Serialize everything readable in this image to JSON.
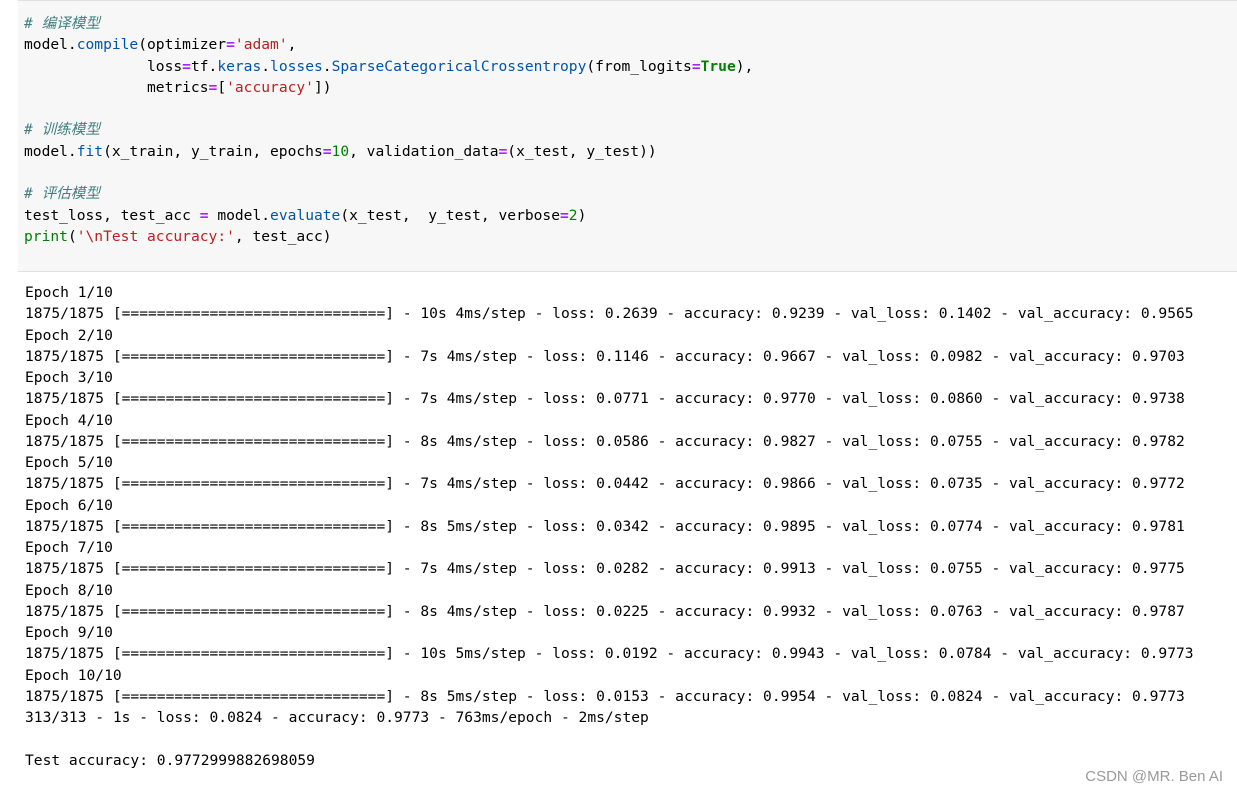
{
  "code": {
    "lines": [
      {
        "type": "comment",
        "text": "# 编译模型"
      },
      {
        "type": "code",
        "parts": [
          {
            "t": "model."
          },
          {
            "t": "compile",
            "c": "attr"
          },
          {
            "t": "(optimizer"
          },
          {
            "t": "=",
            "c": "op"
          },
          {
            "t": "'adam'",
            "c": "str"
          },
          {
            "t": ","
          }
        ]
      },
      {
        "type": "code",
        "parts": [
          {
            "t": "              loss"
          },
          {
            "t": "=",
            "c": "op"
          },
          {
            "t": "tf."
          },
          {
            "t": "keras",
            "c": "attr"
          },
          {
            "t": "."
          },
          {
            "t": "losses",
            "c": "attr"
          },
          {
            "t": "."
          },
          {
            "t": "SparseCategoricalCrossentropy",
            "c": "attr"
          },
          {
            "t": "(from_logits"
          },
          {
            "t": "=",
            "c": "op"
          },
          {
            "t": "True",
            "c": "kw"
          },
          {
            "t": "),"
          }
        ]
      },
      {
        "type": "code",
        "parts": [
          {
            "t": "              metrics"
          },
          {
            "t": "=",
            "c": "op"
          },
          {
            "t": "["
          },
          {
            "t": "'accuracy'",
            "c": "str"
          },
          {
            "t": "])"
          }
        ]
      },
      {
        "type": "blank"
      },
      {
        "type": "comment",
        "text": "# 训练模型"
      },
      {
        "type": "code",
        "parts": [
          {
            "t": "model."
          },
          {
            "t": "fit",
            "c": "attr"
          },
          {
            "t": "(x_train, y_train, epochs"
          },
          {
            "t": "=",
            "c": "op"
          },
          {
            "t": "10",
            "c": "num"
          },
          {
            "t": ", validation_data"
          },
          {
            "t": "=",
            "c": "op"
          },
          {
            "t": "(x_test, y_test))"
          }
        ]
      },
      {
        "type": "blank"
      },
      {
        "type": "comment",
        "text": "# 评估模型"
      },
      {
        "type": "code",
        "parts": [
          {
            "t": "test_loss, test_acc "
          },
          {
            "t": "=",
            "c": "op"
          },
          {
            "t": " model."
          },
          {
            "t": "evaluate",
            "c": "attr"
          },
          {
            "t": "(x_test,  y_test, verbose"
          },
          {
            "t": "=",
            "c": "op"
          },
          {
            "t": "2",
            "c": "num"
          },
          {
            "t": ")"
          }
        ]
      },
      {
        "type": "code",
        "parts": [
          {
            "t": "print",
            "c": "bi"
          },
          {
            "t": "("
          },
          {
            "t": "'\\nTest accuracy:'",
            "c": "str"
          },
          {
            "t": ", test_acc)"
          }
        ]
      }
    ]
  },
  "output": {
    "lines": [
      "Epoch 1/10",
      "1875/1875 [==============================] - 10s 4ms/step - loss: 0.2639 - accuracy: 0.9239 - val_loss: 0.1402 - val_accuracy: 0.9565",
      "Epoch 2/10",
      "1875/1875 [==============================] - 7s 4ms/step - loss: 0.1146 - accuracy: 0.9667 - val_loss: 0.0982 - val_accuracy: 0.9703",
      "Epoch 3/10",
      "1875/1875 [==============================] - 7s 4ms/step - loss: 0.0771 - accuracy: 0.9770 - val_loss: 0.0860 - val_accuracy: 0.9738",
      "Epoch 4/10",
      "1875/1875 [==============================] - 8s 4ms/step - loss: 0.0586 - accuracy: 0.9827 - val_loss: 0.0755 - val_accuracy: 0.9782",
      "Epoch 5/10",
      "1875/1875 [==============================] - 7s 4ms/step - loss: 0.0442 - accuracy: 0.9866 - val_loss: 0.0735 - val_accuracy: 0.9772",
      "Epoch 6/10",
      "1875/1875 [==============================] - 8s 5ms/step - loss: 0.0342 - accuracy: 0.9895 - val_loss: 0.0774 - val_accuracy: 0.9781",
      "Epoch 7/10",
      "1875/1875 [==============================] - 7s 4ms/step - loss: 0.0282 - accuracy: 0.9913 - val_loss: 0.0755 - val_accuracy: 0.9775",
      "Epoch 8/10",
      "1875/1875 [==============================] - 8s 4ms/step - loss: 0.0225 - accuracy: 0.9932 - val_loss: 0.0763 - val_accuracy: 0.9787",
      "Epoch 9/10",
      "1875/1875 [==============================] - 10s 5ms/step - loss: 0.0192 - accuracy: 0.9943 - val_loss: 0.0784 - val_accuracy: 0.9773",
      "Epoch 10/10",
      "1875/1875 [==============================] - 8s 5ms/step - loss: 0.0153 - accuracy: 0.9954 - val_loss: 0.0824 - val_accuracy: 0.9773",
      "313/313 - 1s - loss: 0.0824 - accuracy: 0.9773 - 763ms/epoch - 2ms/step",
      "",
      "Test accuracy: 0.9772999882698059"
    ]
  },
  "watermark": "CSDN @MR. Ben AI"
}
